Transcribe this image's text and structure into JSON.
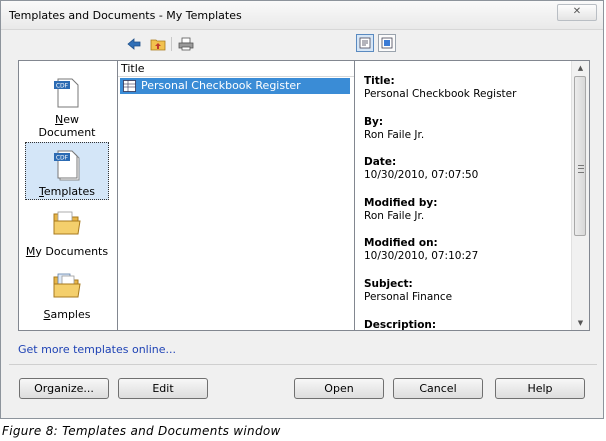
{
  "window": {
    "title": "Templates and Documents - My Templates"
  },
  "toolbar": {
    "back_icon": "back-arrow-icon",
    "up_icon": "folder-up-icon",
    "print_icon": "print-icon",
    "view_preview_icon": "document-preview-icon",
    "view_properties_icon": "document-properties-icon"
  },
  "nav": {
    "items": [
      {
        "label": "New Document",
        "mnemonic": "N",
        "rest": "ew Document"
      },
      {
        "label": "Templates",
        "mnemonic": "T",
        "rest": "emplates"
      },
      {
        "label": "My Documents",
        "mnemonic": "M",
        "rest": "y Documents"
      },
      {
        "label": "Samples",
        "mnemonic": "S",
        "rest": "amples"
      }
    ]
  },
  "list": {
    "column_header": "Title",
    "rows": [
      {
        "title": "Personal Checkbook Register",
        "selected": true
      }
    ]
  },
  "info": {
    "title_label": "Title:",
    "title_value": "Personal Checkbook Register",
    "by_label": "By:",
    "by_value": "Ron Faile Jr.",
    "date_label": "Date:",
    "date_value": "10/30/2010, 07:07:50",
    "modified_by_label": "Modified by:",
    "modified_by_value": "Ron Faile Jr.",
    "modified_on_label": "Modified on:",
    "modified_on_value": "10/30/2010, 07:10:27",
    "subject_label": "Subject:",
    "subject_value": "Personal Finance",
    "description_label": "Description:"
  },
  "link": {
    "text": "Get more templates online..."
  },
  "buttons": {
    "organize": "Organize...",
    "edit": "Edit",
    "open": "Open",
    "cancel": "Cancel",
    "help": "Help"
  },
  "caption": "Figure 8: Templates and Documents window",
  "colors": {
    "selection": "#3a8cd6",
    "link": "#1f43b5",
    "nav_selected": "#d4e6f8"
  }
}
